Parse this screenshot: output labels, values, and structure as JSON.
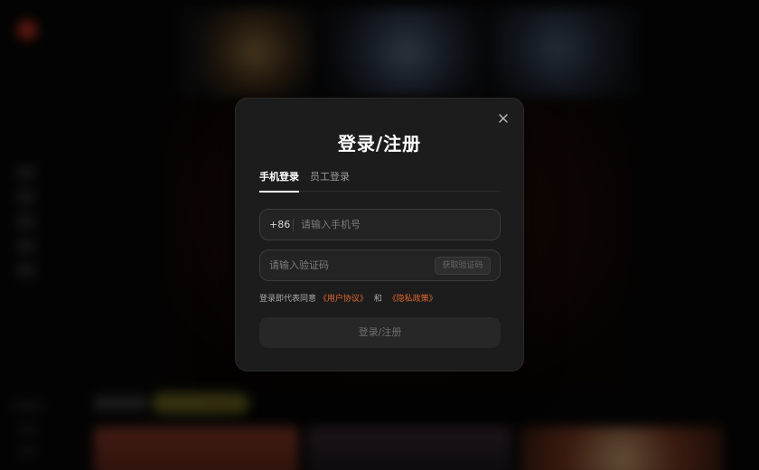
{
  "modal": {
    "title": "登录/注册",
    "tabs": [
      {
        "label": "手机登录",
        "active": true
      },
      {
        "label": "员工登录",
        "active": false
      }
    ],
    "phone": {
      "prefix": "+86",
      "placeholder": "请输入手机号",
      "value": ""
    },
    "code": {
      "placeholder": "请输入验证码",
      "value": "",
      "get_code_label": "获取验证码"
    },
    "agreement": {
      "prefix": "登录即代表同意",
      "user_agreement": "《用户协议》",
      "conjunction": "和",
      "privacy_policy": "《隐私政策》"
    },
    "submit_label": "登录/注册",
    "icons": {
      "close": "close-icon"
    }
  },
  "colors": {
    "accent_link": "#e2662e",
    "modal_bg": "#1c1c1c",
    "brand_logo": "#c2321f"
  }
}
